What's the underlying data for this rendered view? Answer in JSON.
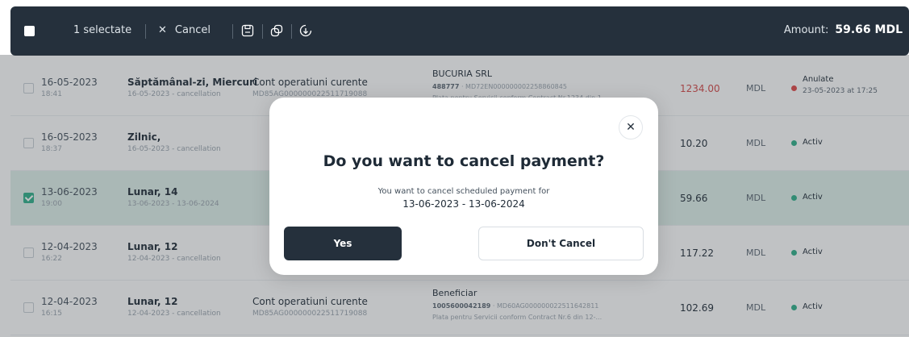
{
  "toolbar": {
    "selected_text": "1 selectate",
    "cancel_label": "Cancel",
    "amount_label": "Amount:",
    "amount_value": "59.66 MDL"
  },
  "rows": [
    {
      "date": "16-05-2023",
      "time": "18:41",
      "frequency": "Săptămânal-zi, Miercuri",
      "frequency_sub": "16-05-2023 - cancellation",
      "account": "Cont operatiuni curente",
      "account_iban": "MD85AG000000022511719088",
      "beneficiary": "BUCURIA SRL",
      "ben_code": "488777",
      "ben_iban": "· MD72EN000000002258860845",
      "ben_desc": "Plata pentru Servicii conform Contract Nr.1234 din 1...",
      "amount": "1234.00",
      "currency": "MDL",
      "status": "Anulate",
      "status_sub": "23-05-2023 at 17:25",
      "checked": false
    },
    {
      "date": "16-05-2023",
      "time": "18:37",
      "frequency": "Zilnic,",
      "frequency_sub": "16-05-2023 - cancellation",
      "amount": "10.20",
      "currency": "MDL",
      "status": "Activ",
      "checked": false
    },
    {
      "date": "13-06-2023",
      "time": "19:00",
      "frequency": "Lunar, 14",
      "frequency_sub": "13-06-2023 - 13-06-2024",
      "amount": "59.66",
      "currency": "MDL",
      "status": "Activ",
      "checked": true
    },
    {
      "date": "12-04-2023",
      "time": "16:22",
      "frequency": "Lunar, 12",
      "frequency_sub": "12-04-2023 - cancellation",
      "amount": "117.22",
      "currency": "MDL",
      "status": "Activ",
      "checked": false
    },
    {
      "date": "12-04-2023",
      "time": "16:15",
      "frequency": "Lunar, 12",
      "frequency_sub": "12-04-2023 - cancellation",
      "account": "Cont operatiuni curente",
      "account_iban": "MD85AG000000022511719088",
      "beneficiary": "Beneficiar",
      "ben_code": "1005600042189",
      "ben_iban": "· MD60AG000000022511642811",
      "ben_desc": "Plata pentru Servicii conform Contract Nr.6 din 12-...",
      "amount": "102.69",
      "currency": "MDL",
      "status": "Activ",
      "checked": false
    }
  ],
  "modal": {
    "title": "Do you want to cancel payment?",
    "text": "You want to cancel scheduled payment for",
    "period": "13-06-2023 - 13-06-2024",
    "yes_label": "Yes",
    "no_label": "Don't Cancel",
    "close_glyph": "✕"
  },
  "colors": {
    "toolbar_bg": "#25303c",
    "selected_row_bg": "#dff0ea",
    "active_dot": "#2fb089",
    "cancelled_dot": "#e04646",
    "cancelled_amount": "#d44747"
  }
}
